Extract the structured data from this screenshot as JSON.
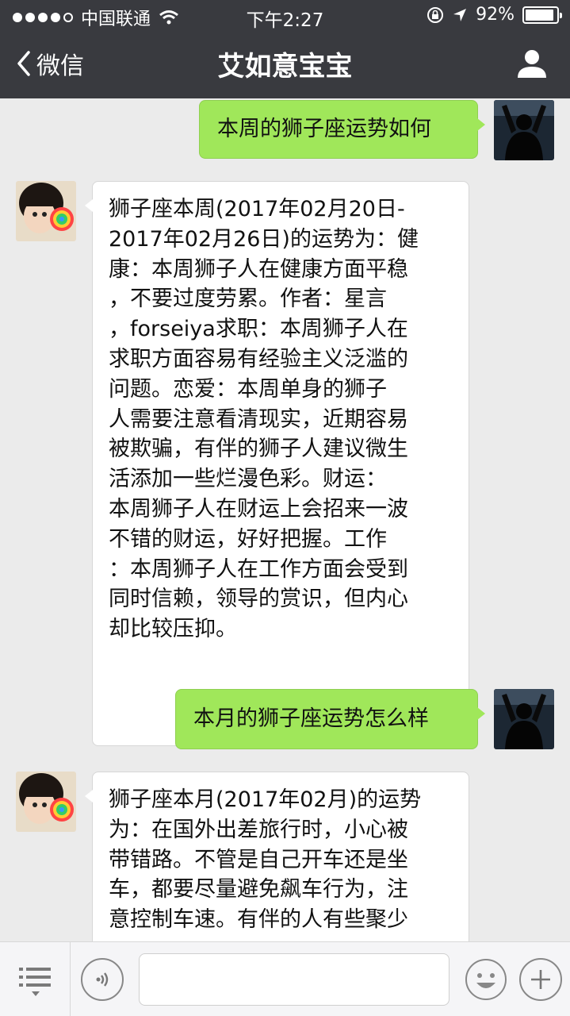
{
  "status_bar": {
    "carrier": "中国联通",
    "time": "下午2:27",
    "battery_text": "92%",
    "battery_level": 0.92,
    "signal_icon": "signal-dots-icon",
    "wifi_icon": "wifi-icon",
    "lock_icon": "rotation-lock-icon",
    "location_icon": "location-arrow-icon"
  },
  "nav": {
    "back_label": "微信",
    "title": "艾如意宝宝",
    "profile_icon": "person-icon"
  },
  "messages": [
    {
      "side": "sent",
      "text": "本周的狮子座运势如何"
    },
    {
      "side": "received",
      "text": "狮子座本周(2017年02月20日-\n2017年02月26日)的运势为：健\n康：本周狮子人在健康方面平稳\n，不要过度劳累。作者：星言\n，forseiya求职：本周狮子人在\n求职方面容易有经验主义泛滥的\n问题。恋爱：本周单身的狮子\n人需要注意看清现实，近期容易\n被欺骗，有伴的狮子人建议微生\n活添加一些烂漫色彩。财运：\n本周狮子人在财运上会招来一波\n不错的财运，好好把握。工作\n：本周狮子人在工作方面会受到\n同时信赖，领导的赏识，但内心\n却比较压抑。"
    },
    {
      "side": "sent",
      "text": "本月的狮子座运势怎么样"
    },
    {
      "side": "received",
      "text": "狮子座本月(2017年02月)的运势\n为：在国外出差旅行时，小心被\n带错路。不管是自己开车还是坐\n车，都要尽量避免飙车行为，注\n意控制车速。有伴的人有些聚少"
    }
  ],
  "input_bar": {
    "menu_icon": "menu-list-icon",
    "voice_icon": "voice-icon",
    "input_value": "",
    "emoji_icon": "emoji-icon",
    "plus_icon": "plus-icon"
  },
  "colors": {
    "nav_bg": "#393a3f",
    "chat_bg": "#ebebeb",
    "sent_bubble": "#a0e75a",
    "received_bubble": "#ffffff"
  }
}
